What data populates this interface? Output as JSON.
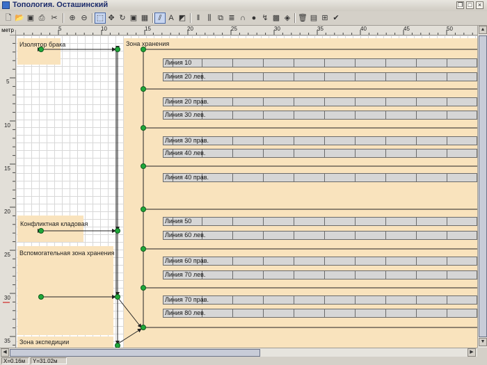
{
  "window": {
    "title": "Топология. Осташинский"
  },
  "ruler": {
    "unit_label": "метр",
    "h_ticks": [
      "5",
      "10",
      "15",
      "20",
      "25",
      "30",
      "35",
      "40",
      "45",
      "50"
    ],
    "v_ticks": [
      "5",
      "10",
      "15",
      "20",
      "25",
      "30",
      "35"
    ]
  },
  "zones": {
    "isolator": "Изолятор брака",
    "storage": "Зона хранения",
    "conflict": "Конфликтная кладовая",
    "aux": "Вспомогательная зона хранения",
    "expedition": "Зона экспедиции"
  },
  "lines": [
    "Линия 10",
    "Линия 20 лев.",
    "Линия 20 прав.",
    "Линия 30 лев.",
    "Линия 30 прав.",
    "Линия 40 лев.",
    "Линия 40 прав.",
    "Линия 50",
    "Линия 60 лев.",
    "Линия 60 прав.",
    "Линия 70 лев.",
    "Линия 70 прав.",
    "Линия 80 лев."
  ],
  "status": {
    "x": "X=0.16м",
    "y": "Y=31.02м"
  },
  "colors": {
    "zone": "#f9e3bd",
    "node": "#1fa83a",
    "line_cell": "#d6d6d6"
  },
  "toolbar_icons": [
    "open-icon",
    "folder-icon",
    "save-icon",
    "print-icon",
    "cut-icon",
    "zoom-in-icon",
    "zoom-out-icon",
    "select-icon",
    "move-icon",
    "rotate-icon",
    "fit-icon",
    "grid-icon",
    "align-icon",
    "text-icon",
    "color-icon",
    "line-icon",
    "rack-icon",
    "copy-icon",
    "stack-icon",
    "link-icon",
    "node-icon",
    "route-icon",
    "paint-icon",
    "layers-icon",
    "delete-icon",
    "properties-icon",
    "tree-icon",
    "check-icon"
  ]
}
